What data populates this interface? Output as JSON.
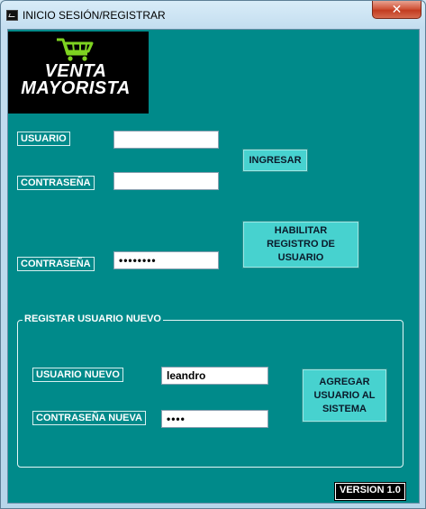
{
  "window": {
    "title": "INICIO SESIÓN/REGISTRAR",
    "close_glyph": "✕",
    "icon": "app-icon"
  },
  "logo": {
    "line1": "VENTA",
    "line2": "MAYORISTA",
    "icon": "shopping-cart-icon",
    "icon_color": "#7ed321",
    "background": "#000000"
  },
  "login": {
    "user_label": "USUARIO",
    "user_value": "",
    "password_label": "CONTRASEÑA",
    "password_value": "",
    "login_button": "INGRESAR"
  },
  "admin": {
    "password_label": "CONTRASEÑA",
    "password_value": "••••••••",
    "enable_button": "HABILITAR\nREGISTRO DE\nUSUARIO"
  },
  "register": {
    "group_title": "REGISTAR USUARIO NUEVO",
    "new_user_label": "USUARIO NUEVO",
    "new_user_value": "leandro",
    "new_password_label": "CONTRASEÑA NUEVA",
    "new_password_value": "••••",
    "add_button": "AGREGAR\nUSUARIO AL\nSISTEMA"
  },
  "footer": {
    "version": "VERSION 1.0"
  },
  "colors": {
    "panel_background": "#008a8a",
    "button_background": "#47d2cf",
    "label_border": "#d8f0f0"
  }
}
